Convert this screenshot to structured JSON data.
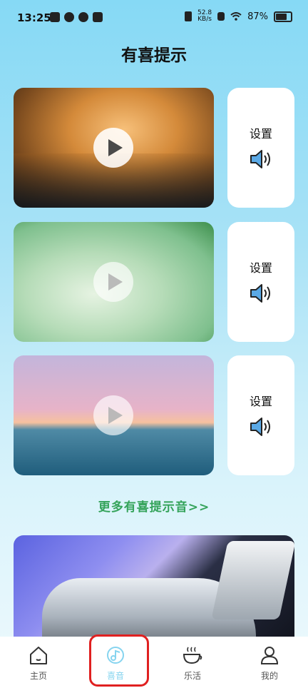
{
  "status_bar": {
    "time": "13:25",
    "net_speed_value": "52.8",
    "net_speed_unit": "KB/s",
    "battery": "87%"
  },
  "page": {
    "title": "有喜提示"
  },
  "cards": [
    {
      "setting_label": "设置",
      "theme": "sunset-grass"
    },
    {
      "setting_label": "设置",
      "theme": "green-leaves"
    },
    {
      "setting_label": "设置",
      "theme": "ocean-sunset"
    }
  ],
  "more_link": "更多有喜提示音>>",
  "tabs": [
    {
      "label": "主页",
      "icon": "home-icon"
    },
    {
      "label": "喜音",
      "icon": "music-note-icon",
      "active": true
    },
    {
      "label": "乐活",
      "icon": "coffee-cup-icon"
    },
    {
      "label": "我的",
      "icon": "user-icon"
    }
  ],
  "colors": {
    "accent_green": "#34a35a",
    "active_tab": "#86d4ef",
    "highlight": "#e02020"
  }
}
